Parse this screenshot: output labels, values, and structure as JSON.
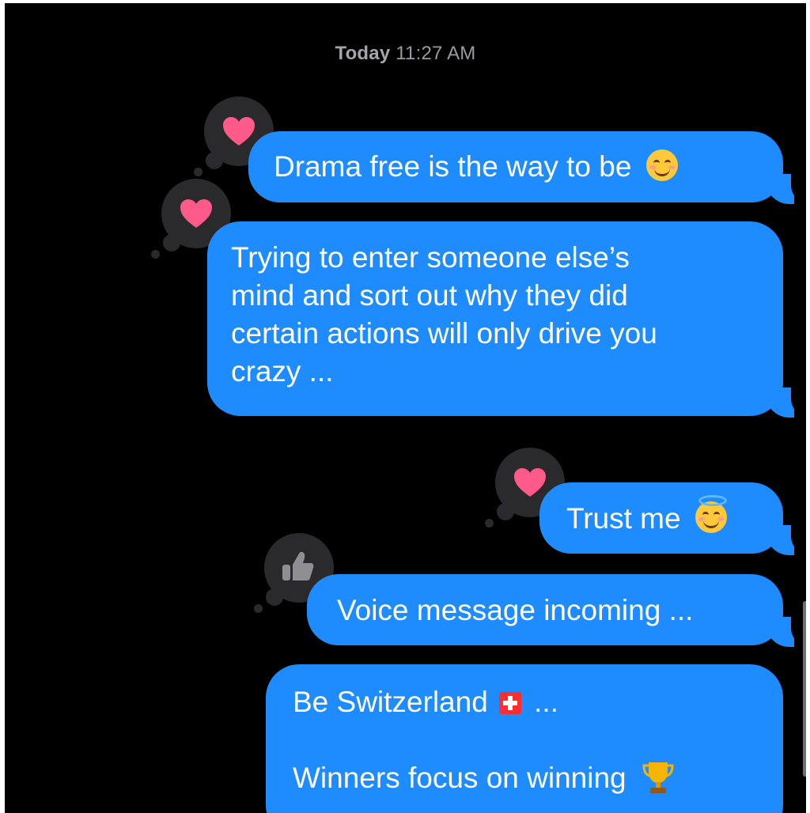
{
  "timestamp": {
    "day": "Today",
    "time": "11:27 AM"
  },
  "messages": [
    {
      "text": "Drama free is the way to be",
      "emoji": "smiling-face-icon",
      "tapback": "heart"
    },
    {
      "lines": [
        "Trying to enter someone else’s",
        "mind and sort out why they did",
        "certain actions will only drive you",
        "crazy ..."
      ],
      "tapback": "heart"
    },
    {
      "text": "Trust me",
      "emoji": "smiling-face-with-halo-icon",
      "tapback": "heart"
    },
    {
      "text": "Voice message incoming ...",
      "tapback": "thumbs-up"
    },
    {
      "line1_a": "Be Switzerland",
      "line1_b": "...",
      "line2": "Winners focus on winning"
    }
  ],
  "colors": {
    "bubble": "#1e8cff",
    "background": "#000000",
    "tapback_bg": "#2a2a2c",
    "heart": "#ff5a8a"
  }
}
